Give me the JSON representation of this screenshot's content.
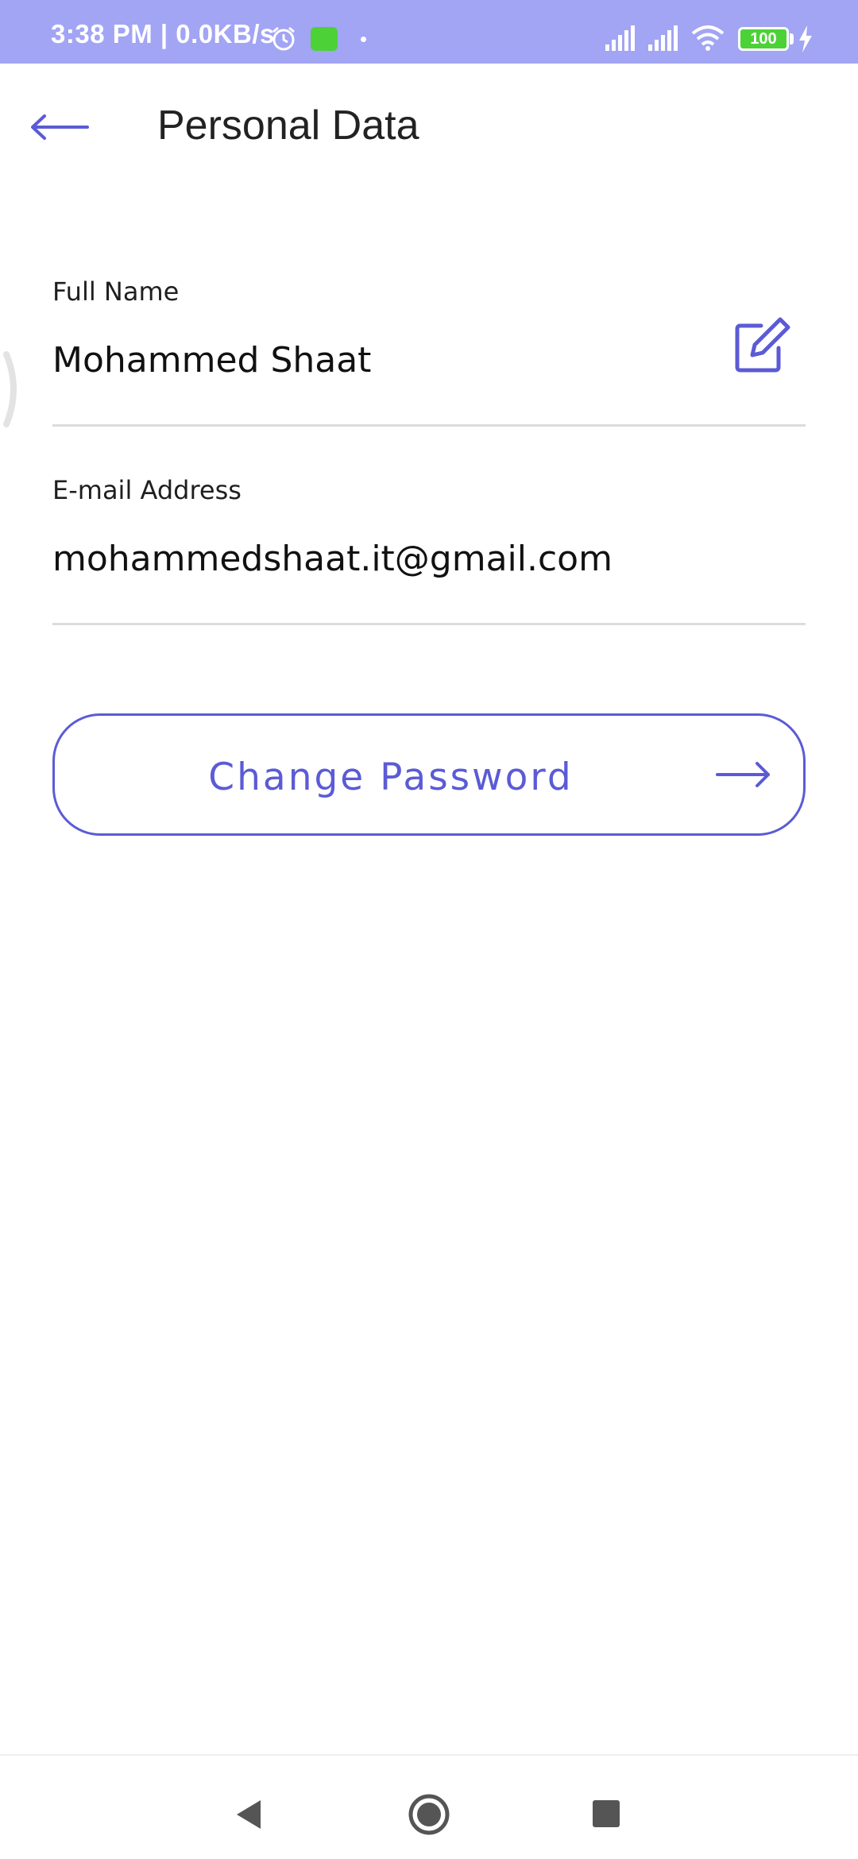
{
  "status_bar": {
    "time": "3:38 PM | 0.0KB/s",
    "battery": "100",
    "icons": [
      "alarm-icon",
      "app-notification-icon",
      "signal-icon",
      "signal-icon",
      "wifi-icon",
      "battery-icon",
      "charging-icon"
    ]
  },
  "header": {
    "back_icon": "arrow-left-icon",
    "title": "Personal Data"
  },
  "fields": [
    {
      "label": "Full Name",
      "value": "Mohammed Shaat",
      "action_icon": "edit-icon"
    },
    {
      "label": "E-mail Address",
      "value": "mohammedshaat.it@gmail.com"
    }
  ],
  "change_password": {
    "label": "Change Password",
    "icon": "arrow-right-icon"
  },
  "nav_bar": {
    "icons": [
      "nav-back-icon",
      "nav-home-icon",
      "nav-recents-icon"
    ]
  },
  "colors": {
    "accent": "#5b5bd6",
    "status_bar": "#a2a4f4",
    "divider": "#dcdcdc"
  }
}
